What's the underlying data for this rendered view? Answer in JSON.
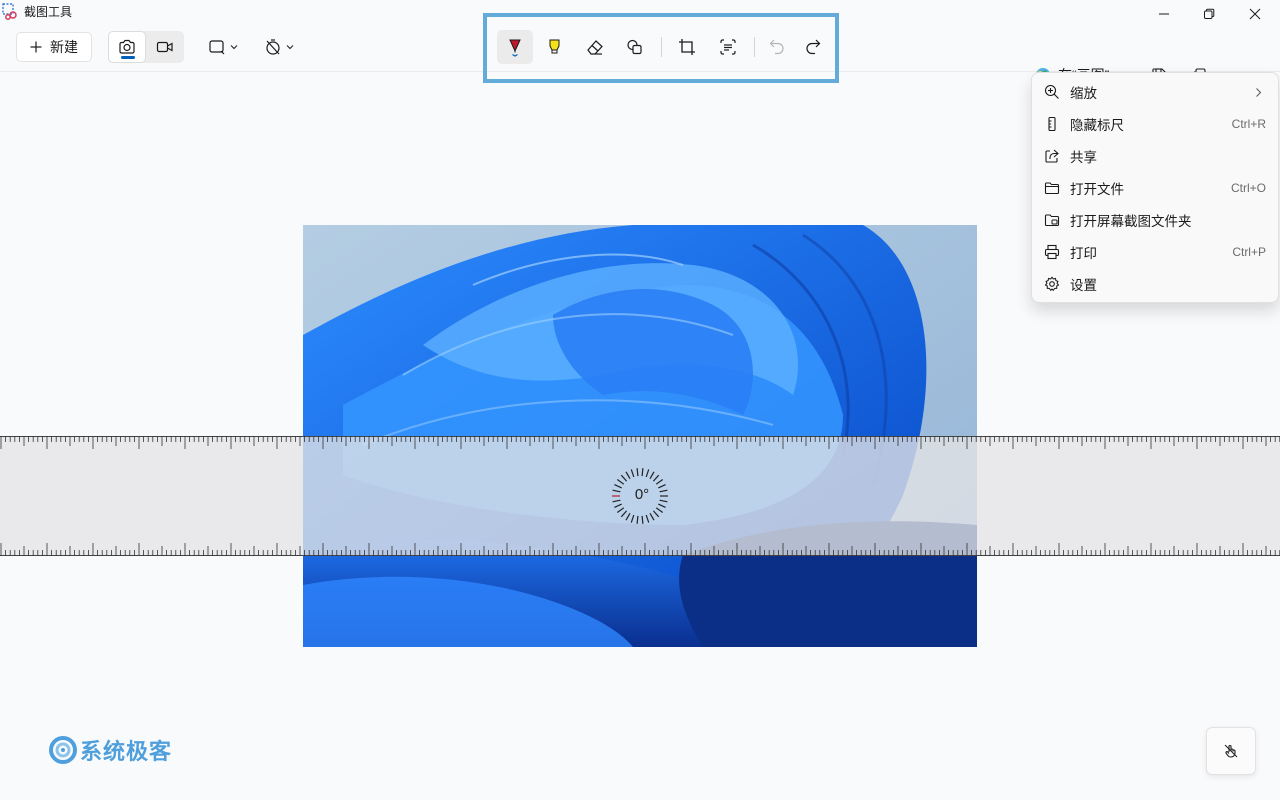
{
  "app": {
    "title": "截图工具"
  },
  "toolbar": {
    "new_label": "新建",
    "modes": [
      {
        "name": "screenshot-mode",
        "active": true
      },
      {
        "name": "video-mode",
        "active": false
      }
    ],
    "snip_shape_icon": "rectangle-snip-icon",
    "delay_icon": "no-delay-icon",
    "open_in_paint_label": "在“画图”…",
    "tools": [
      "ballpoint-pen",
      "highlighter",
      "eraser",
      "shapes",
      "crop",
      "text-actions",
      "undo",
      "redo"
    ]
  },
  "menu": {
    "items": [
      {
        "icon": "zoom-icon",
        "label": "缩放",
        "shortcut": "",
        "submenu": true
      },
      {
        "icon": "ruler-icon",
        "label": "隐藏标尺",
        "shortcut": "Ctrl+R"
      },
      {
        "icon": "share-icon",
        "label": "共享",
        "shortcut": ""
      },
      {
        "icon": "folder-icon",
        "label": "打开文件",
        "shortcut": "Ctrl+O"
      },
      {
        "icon": "folder-image-icon",
        "label": "打开屏幕截图文件夹",
        "shortcut": ""
      },
      {
        "icon": "print-icon",
        "label": "打印",
        "shortcut": "Ctrl+P"
      },
      {
        "icon": "settings-icon",
        "label": "设置",
        "shortcut": ""
      }
    ]
  },
  "ruler": {
    "angle": "0°"
  },
  "watermark": {
    "text": "系统极客"
  },
  "colors": {
    "accent": "#005fb8",
    "highlight_box": "#63abd9",
    "pen_red": "#c0172b",
    "highlighter_yellow": "#f5e11a"
  }
}
